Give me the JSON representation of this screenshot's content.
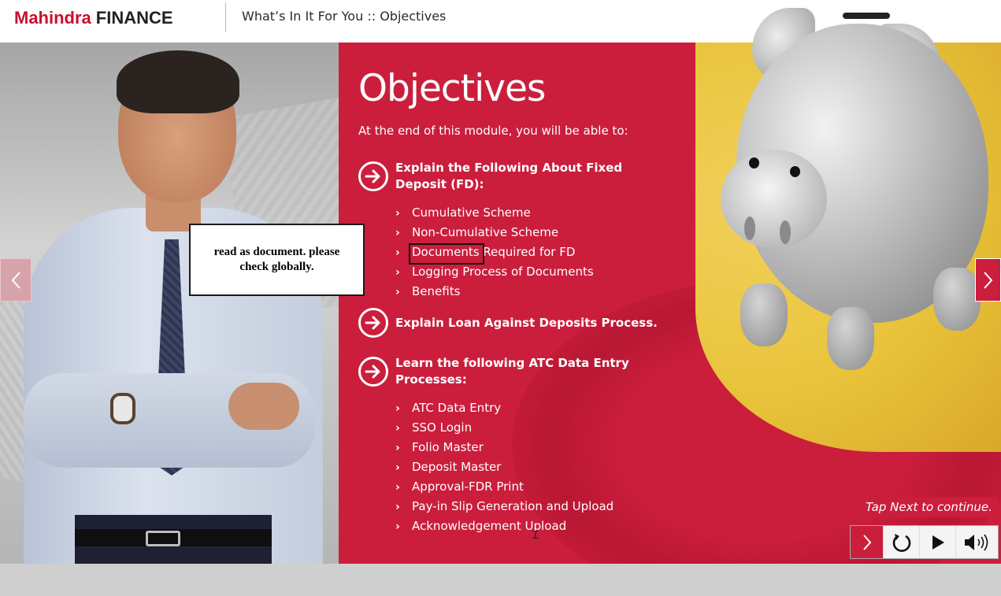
{
  "header": {
    "logo_brand": "Mahindra",
    "logo_suffix": "FINANCE",
    "title": "What’s In It For You :: Objectives"
  },
  "slide": {
    "title": "Objectives",
    "intro": "At the end of this module, you will be able to:",
    "objectives": [
      {
        "heading": "Explain the Following About Fixed Deposit (FD):",
        "items": [
          "Cumulative Scheme",
          "Non-Cumulative Scheme",
          "Documents Required for FD",
          "Logging Process of Documents",
          "Benefits"
        ]
      },
      {
        "heading": "Explain Loan Against Deposits Process.",
        "items": []
      },
      {
        "heading": "Learn the following ATC Data Entry Processes:",
        "items": [
          "ATC Data Entry",
          "SSO Login",
          "Folio Master",
          "Deposit Master",
          "Approval-FDR Print",
          "Pay-in Slip Generation and Upload",
          "Acknowledgement Upload"
        ]
      }
    ],
    "highlighted_word": "Documents",
    "item_doc_rest": " Required for FD"
  },
  "comment": {
    "text": "read as document. please check globally."
  },
  "tap_next": "Tap Next to continue.",
  "icons": {
    "prev": "chevron-left-icon",
    "next": "chevron-right-icon",
    "objective_bullet": "circle-arrow-right-icon",
    "sub_bullet": "chevron-right-small-icon",
    "replay": "replay-icon",
    "play": "play-icon",
    "audio": "speaker-icon"
  },
  "colors": {
    "brand_red": "#cb1e3c",
    "accent_yellow": "#e8c33a",
    "white": "#ffffff"
  }
}
